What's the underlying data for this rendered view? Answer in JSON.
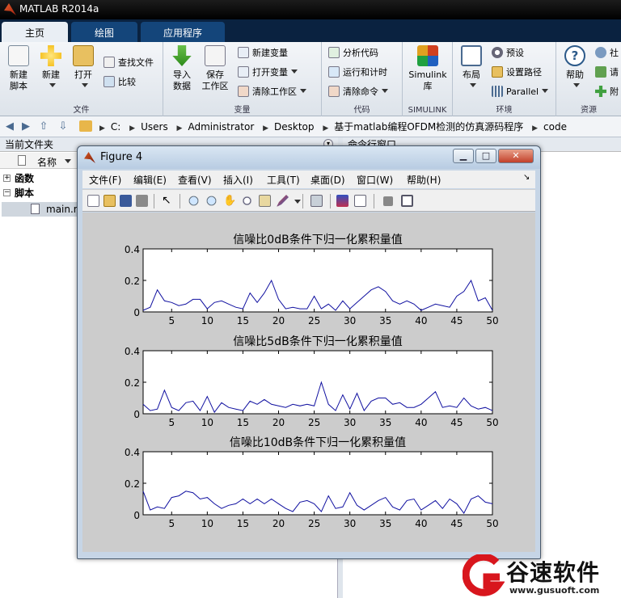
{
  "app": {
    "title": "MATLAB R2014a"
  },
  "tabs": [
    "主页",
    "绘图",
    "应用程序"
  ],
  "ribbon": {
    "file": {
      "caption": "文件",
      "new_script": "新建\n脚本",
      "new": "新建",
      "open": "打开",
      "find_files": "查找文件",
      "compare": "比较"
    },
    "variable": {
      "caption": "变量",
      "import_data": "导入\n数据",
      "save_workspace": "保存\n工作区",
      "new_variable": "新建变量",
      "open_variable": "打开变量",
      "clear_workspace": "清除工作区"
    },
    "code": {
      "caption": "代码",
      "analyze_code": "分析代码",
      "run_and_time": "运行和计时",
      "clear_commands": "清除命令"
    },
    "simulink": {
      "caption": "SIMULINK",
      "library": "Simulink\n库"
    },
    "environment": {
      "caption": "环境",
      "layout": "布局",
      "preferences": "预设",
      "set_path": "设置路径",
      "parallel": "Parallel"
    },
    "resources": {
      "caption": "资源",
      "help": "帮助",
      "community": "社",
      "request": "请",
      "addons": "附"
    }
  },
  "address": {
    "crumbs": [
      "C:",
      "Users",
      "Administrator",
      "Desktop",
      "基于matlab编程OFDM检测的仿真源码程序",
      "code"
    ]
  },
  "left_panel": {
    "title": "当前文件夹",
    "column_name": "名称",
    "groups": [
      {
        "sign": "+",
        "label": "函数"
      },
      {
        "sign": "−",
        "label": "脚本"
      }
    ],
    "file": "main.m"
  },
  "right_panel": {
    "title": "命令行窗口"
  },
  "figure": {
    "title": "Figure 4",
    "menu": [
      "文件(F)",
      "编辑(E)",
      "查看(V)",
      "插入(I)",
      "工具(T)",
      "桌面(D)",
      "窗口(W)",
      "帮助(H)"
    ]
  },
  "chart_data": [
    {
      "type": "line",
      "title": "信噪比0dB条件下归一化累积量值",
      "xlim": [
        1,
        50
      ],
      "ylim": [
        0,
        0.4
      ],
      "xticks": [
        5,
        10,
        15,
        20,
        25,
        30,
        35,
        40,
        45,
        50
      ],
      "yticks": [
        0,
        0.2,
        0.4
      ],
      "color": "#1010a0",
      "x": [
        1,
        2,
        3,
        4,
        5,
        6,
        7,
        8,
        9,
        10,
        11,
        12,
        13,
        14,
        15,
        16,
        17,
        18,
        19,
        20,
        21,
        22,
        23,
        24,
        25,
        26,
        27,
        28,
        29,
        30,
        31,
        32,
        33,
        34,
        35,
        36,
        37,
        38,
        39,
        40,
        41,
        42,
        43,
        44,
        45,
        46,
        47,
        48,
        49,
        50
      ],
      "y": [
        0.01,
        0.03,
        0.14,
        0.07,
        0.06,
        0.04,
        0.05,
        0.08,
        0.08,
        0.02,
        0.06,
        0.07,
        0.05,
        0.03,
        0.02,
        0.12,
        0.06,
        0.12,
        0.2,
        0.08,
        0.02,
        0.03,
        0.02,
        0.02,
        0.1,
        0.02,
        0.05,
        0.01,
        0.07,
        0.02,
        0.06,
        0.1,
        0.14,
        0.16,
        0.13,
        0.07,
        0.05,
        0.07,
        0.05,
        0.01,
        0.03,
        0.05,
        0.04,
        0.03,
        0.1,
        0.13,
        0.2,
        0.07,
        0.09,
        0.01
      ]
    },
    {
      "type": "line",
      "title": "信噪比5dB条件下归一化累积量值",
      "xlim": [
        1,
        50
      ],
      "ylim": [
        0,
        0.4
      ],
      "xticks": [
        5,
        10,
        15,
        20,
        25,
        30,
        35,
        40,
        45,
        50
      ],
      "yticks": [
        0,
        0.2,
        0.4
      ],
      "color": "#1010a0",
      "x": [
        1,
        2,
        3,
        4,
        5,
        6,
        7,
        8,
        9,
        10,
        11,
        12,
        13,
        14,
        15,
        16,
        17,
        18,
        19,
        20,
        21,
        22,
        23,
        24,
        25,
        26,
        27,
        28,
        29,
        30,
        31,
        32,
        33,
        34,
        35,
        36,
        37,
        38,
        39,
        40,
        41,
        42,
        43,
        44,
        45,
        46,
        47,
        48,
        49,
        50
      ],
      "y": [
        0.06,
        0.02,
        0.03,
        0.15,
        0.04,
        0.02,
        0.07,
        0.08,
        0.02,
        0.11,
        0.01,
        0.07,
        0.04,
        0.03,
        0.02,
        0.08,
        0.06,
        0.09,
        0.06,
        0.05,
        0.04,
        0.06,
        0.05,
        0.06,
        0.05,
        0.2,
        0.06,
        0.02,
        0.12,
        0.03,
        0.13,
        0.02,
        0.08,
        0.1,
        0.1,
        0.06,
        0.07,
        0.04,
        0.04,
        0.06,
        0.1,
        0.14,
        0.04,
        0.05,
        0.04,
        0.1,
        0.05,
        0.03,
        0.04,
        0.02
      ]
    },
    {
      "type": "line",
      "title": "信噪比10dB条件下归一化累积量值",
      "xlim": [
        1,
        50
      ],
      "ylim": [
        0,
        0.4
      ],
      "xticks": [
        5,
        10,
        15,
        20,
        25,
        30,
        35,
        40,
        45,
        50
      ],
      "yticks": [
        0,
        0.2,
        0.4
      ],
      "color": "#1010a0",
      "x": [
        1,
        2,
        3,
        4,
        5,
        6,
        7,
        8,
        9,
        10,
        11,
        12,
        13,
        14,
        15,
        16,
        17,
        18,
        19,
        20,
        21,
        22,
        23,
        24,
        25,
        26,
        27,
        28,
        29,
        30,
        31,
        32,
        33,
        34,
        35,
        36,
        37,
        38,
        39,
        40,
        41,
        42,
        43,
        44,
        45,
        46,
        47,
        48,
        49,
        50
      ],
      "y": [
        0.15,
        0.03,
        0.05,
        0.04,
        0.11,
        0.12,
        0.15,
        0.14,
        0.1,
        0.11,
        0.07,
        0.04,
        0.06,
        0.07,
        0.1,
        0.07,
        0.1,
        0.07,
        0.1,
        0.07,
        0.04,
        0.02,
        0.08,
        0.09,
        0.07,
        0.02,
        0.12,
        0.04,
        0.05,
        0.14,
        0.06,
        0.03,
        0.06,
        0.09,
        0.11,
        0.05,
        0.03,
        0.09,
        0.1,
        0.03,
        0.06,
        0.09,
        0.04,
        0.1,
        0.07,
        0.01,
        0.1,
        0.12,
        0.08,
        0.07
      ]
    }
  ],
  "watermark": {
    "brand": "谷速软件",
    "url": "www.gusuoft.com",
    "red": "#d8161d"
  }
}
